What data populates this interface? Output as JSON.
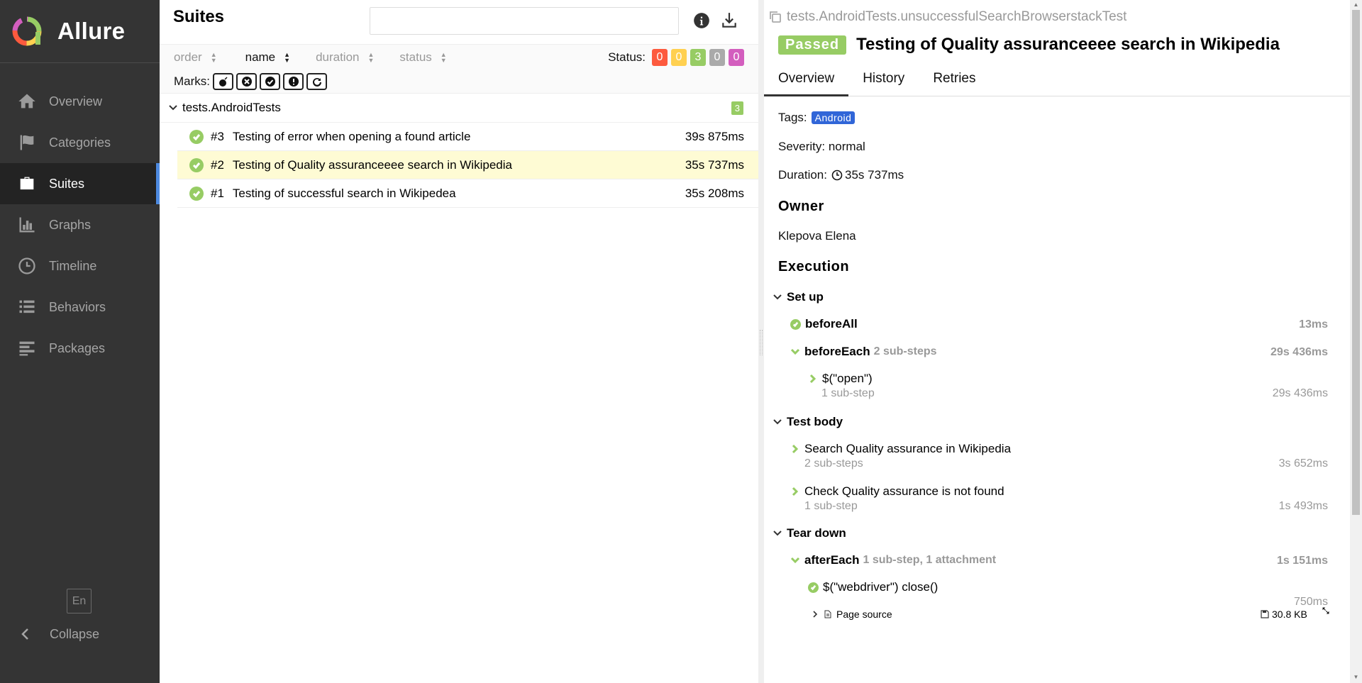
{
  "app": {
    "brand": "Allure",
    "nav": [
      {
        "id": "overview",
        "label": "Overview",
        "icon": "home-icon"
      },
      {
        "id": "categories",
        "label": "Categories",
        "icon": "flag-icon"
      },
      {
        "id": "suites",
        "label": "Suites",
        "icon": "briefcase-icon"
      },
      {
        "id": "graphs",
        "label": "Graphs",
        "icon": "bar-chart-icon"
      },
      {
        "id": "timeline",
        "label": "Timeline",
        "icon": "clock-icon"
      },
      {
        "id": "behaviors",
        "label": "Behaviors",
        "icon": "list-icon"
      },
      {
        "id": "packages",
        "label": "Packages",
        "icon": "align-left-icon"
      }
    ],
    "active_nav": "suites",
    "language": "En",
    "collapse_label": "Collapse"
  },
  "suites": {
    "title": "Suites",
    "search_value": "",
    "sort": [
      {
        "label": "order",
        "active": false
      },
      {
        "label": "name",
        "active": true
      },
      {
        "label": "duration",
        "active": false
      },
      {
        "label": "status",
        "active": false
      }
    ],
    "status_label": "Status:",
    "status_badges": [
      {
        "value": "0",
        "color": "#fd5a3e"
      },
      {
        "value": "0",
        "color": "#ffd050"
      },
      {
        "value": "3",
        "color": "#97cc64"
      },
      {
        "value": "0",
        "color": "#aaaaaa"
      },
      {
        "value": "0",
        "color": "#d35ebe"
      }
    ],
    "marks_label": "Marks:",
    "group": {
      "name": "tests.AndroidTests",
      "count": "3"
    },
    "rows": [
      {
        "num": "#3",
        "name": "Testing of error when opening a found article",
        "duration": "39s 875ms",
        "selected": false
      },
      {
        "num": "#2",
        "name": "Testing of Quality assuranceeee search in Wikipedia",
        "duration": "35s 737ms",
        "selected": true
      },
      {
        "num": "#1",
        "name": "Testing of successful search in Wikipedea",
        "duration": "35s 208ms",
        "selected": false
      }
    ]
  },
  "detail": {
    "path": "tests.AndroidTests.unsuccessfulSearchBrowserstackTest",
    "status": "Passed",
    "title": "Testing of Quality assuranceeee search in Wikipedia",
    "tabs": [
      "Overview",
      "History",
      "Retries"
    ],
    "tags_label": "Tags:",
    "tag": "Android",
    "severity": "Severity: normal",
    "duration_label": "Duration:",
    "duration": "35s 737ms",
    "owner_heading": "Owner",
    "owner": "Klepova Elena",
    "execution_heading": "Execution",
    "setup": {
      "label": "Set up",
      "before_all": {
        "name": "beforeAll",
        "duration": "13ms"
      },
      "before_each": {
        "name": "beforeEach",
        "sub": "2 sub-steps",
        "duration": "29s 436ms"
      },
      "open_step": {
        "name": "$(\"open\")",
        "sub": "1 sub-step",
        "duration": "29s 436ms"
      }
    },
    "body": {
      "label": "Test body",
      "steps": [
        {
          "name": "Search Quality assurance in Wikipedia",
          "sub": "2 sub-steps",
          "duration": "3s 652ms"
        },
        {
          "name": "Check Quality assurance is not found",
          "sub": "1 sub-step",
          "duration": "1s 493ms"
        }
      ]
    },
    "teardown": {
      "label": "Tear down",
      "after_each": {
        "name": "afterEach",
        "sub": "1 sub-step, 1 attachment",
        "duration": "1s 151ms"
      },
      "close_step": {
        "name": "$(\"webdriver\") close()",
        "duration": "750ms"
      },
      "attachment": {
        "name": "Page source",
        "size": "30.8 KB"
      }
    }
  }
}
